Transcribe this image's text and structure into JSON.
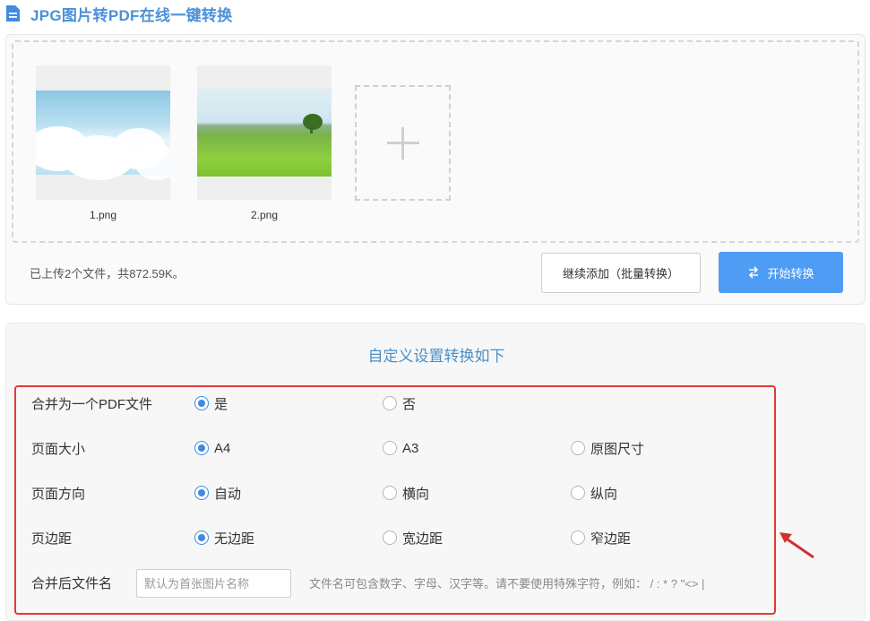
{
  "page": {
    "title": "JPG图片转PDF在线一键转换"
  },
  "upload": {
    "files": [
      {
        "name": "1.png"
      },
      {
        "name": "2.png"
      }
    ],
    "status": "已上传2个文件，共872.59K。",
    "continue_label": "继续添加（批量转换）",
    "start_label": "开始转换"
  },
  "settings": {
    "heading": "自定义设置转换如下",
    "merge": {
      "label": "合并为一个PDF文件",
      "options": [
        "是",
        "否"
      ],
      "selected": "是"
    },
    "page_size": {
      "label": "页面大小",
      "options": [
        "A4",
        "A3",
        "原图尺寸"
      ],
      "selected": "A4"
    },
    "orientation": {
      "label": "页面方向",
      "options": [
        "自动",
        "横向",
        "纵向"
      ],
      "selected": "自动"
    },
    "margin": {
      "label": "页边距",
      "options": [
        "无边距",
        "宽边距",
        "窄边距"
      ],
      "selected": "无边距"
    },
    "filename": {
      "label": "合并后文件名",
      "placeholder": "默认为首张图片名称",
      "value": "",
      "hint": "文件名可包含数字、字母、汉字等。请不要使用特殊字符，例如：  / : * ? \"<> |"
    }
  },
  "colors": {
    "accent": "#4f9cf4",
    "title": "#4a90d9",
    "highlight": "#e53935"
  },
  "icons": [
    "document-icon",
    "plus-icon",
    "swap-icon",
    "arrow-icon"
  ]
}
